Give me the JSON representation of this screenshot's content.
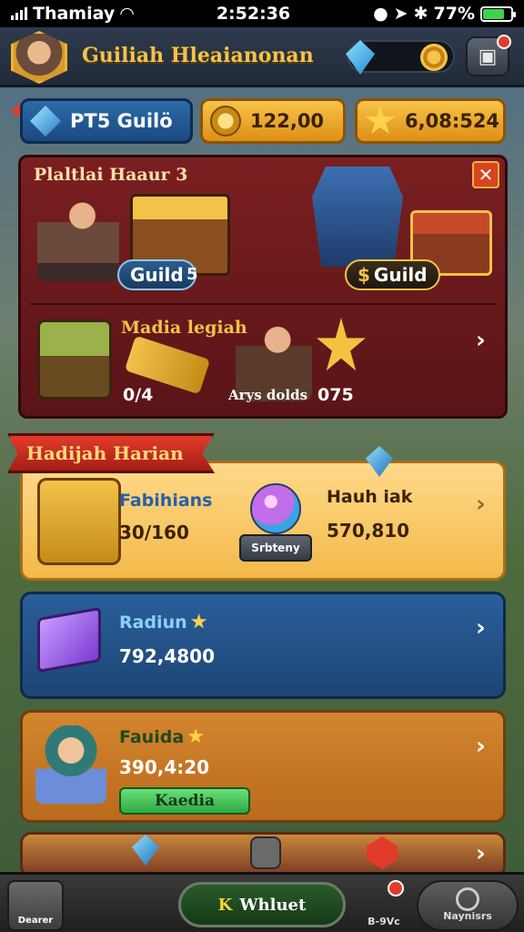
{
  "status_bar": {
    "carrier": "Thamiay",
    "time": "2:52:36",
    "battery": "77%",
    "battery_level": 0.77
  },
  "header": {
    "title": "Guiliah Hleaianonan"
  },
  "resources": {
    "guild_label": "PT5 Guilö",
    "coins": "122,00",
    "timer": "6,08:524"
  },
  "guild_panel": {
    "title": "Plaltlai Haaur 3",
    "close_label": "✕",
    "guild_tag_1": "Guild",
    "guild_tag_1_count": "5",
    "guild_tag_2": "Guild",
    "row2_title": "Madia legiah",
    "value_1": "0/4",
    "value_2": "Arys dolds",
    "value_3": "075"
  },
  "daily": {
    "ribbon": "Hadijah Harian",
    "card1": {
      "title": "Fabihians",
      "value": "30/160",
      "button": "Srbteny",
      "right_title": "Hauh iak",
      "right_value": "570,810"
    },
    "card2": {
      "title": "Radiun",
      "value": "792,4800"
    },
    "card3": {
      "title": "Fauida",
      "value": "390,4:20",
      "button": "Kaedia"
    }
  },
  "bottom_nav": {
    "home": "Dearer",
    "main_icon": "K",
    "main_label": "Whluet",
    "middle": "B-9Vc",
    "players": "Naynisrs"
  },
  "colors": {
    "gold": "#f3c24a",
    "red_panel": "#7a1f20",
    "blue_card": "#2a5f9a",
    "orange_card": "#d4852e",
    "green_button": "#2ea843"
  }
}
